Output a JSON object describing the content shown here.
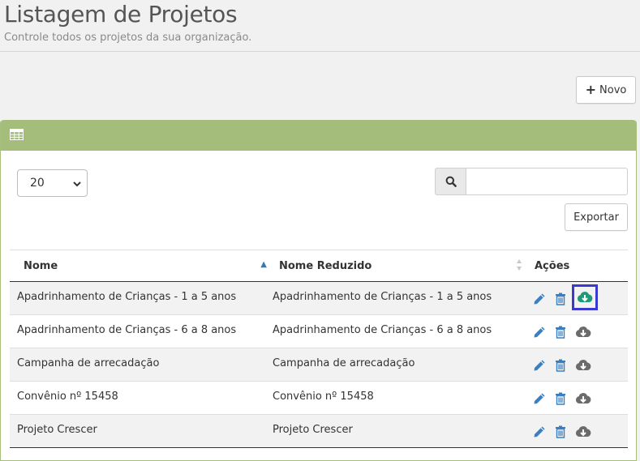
{
  "header": {
    "title": "Listagem de Projetos",
    "subtitle": "Controle todos os projetos da sua organização."
  },
  "toolbar": {
    "new_label": "Novo",
    "export_label": "Exportar"
  },
  "panel": {
    "icon": "table-icon"
  },
  "page_size": {
    "selected": "20"
  },
  "search": {
    "placeholder": "",
    "value": ""
  },
  "table": {
    "columns": [
      "Nome",
      "Nome Reduzido",
      "Ações"
    ],
    "rows": [
      {
        "nome": "Apadrinhamento de Crianças - 1 a 5 anos",
        "reduzido": "Apadrinhamento de Crianças - 1 a 5 anos"
      },
      {
        "nome": "Apadrinhamento de Crianças - 6 a 8 anos",
        "reduzido": "Apadrinhamento de Crianças - 6 a 8 anos"
      },
      {
        "nome": "Campanha de arrecadação",
        "reduzido": "Campanha de arrecadação"
      },
      {
        "nome": "Convênio nº 15458",
        "reduzido": "Convênio nº 15458"
      },
      {
        "nome": "Projeto Crescer",
        "reduzido": "Projeto Crescer"
      }
    ]
  },
  "colors": {
    "panel_header": "#a4bd7a",
    "edit_icon": "#3a7fc1",
    "delete_icon": "#3a7fc1",
    "download_icon_active": "#1e9a78",
    "download_icon": "#6b6b6b",
    "highlight_border": "#3a3ad3"
  }
}
